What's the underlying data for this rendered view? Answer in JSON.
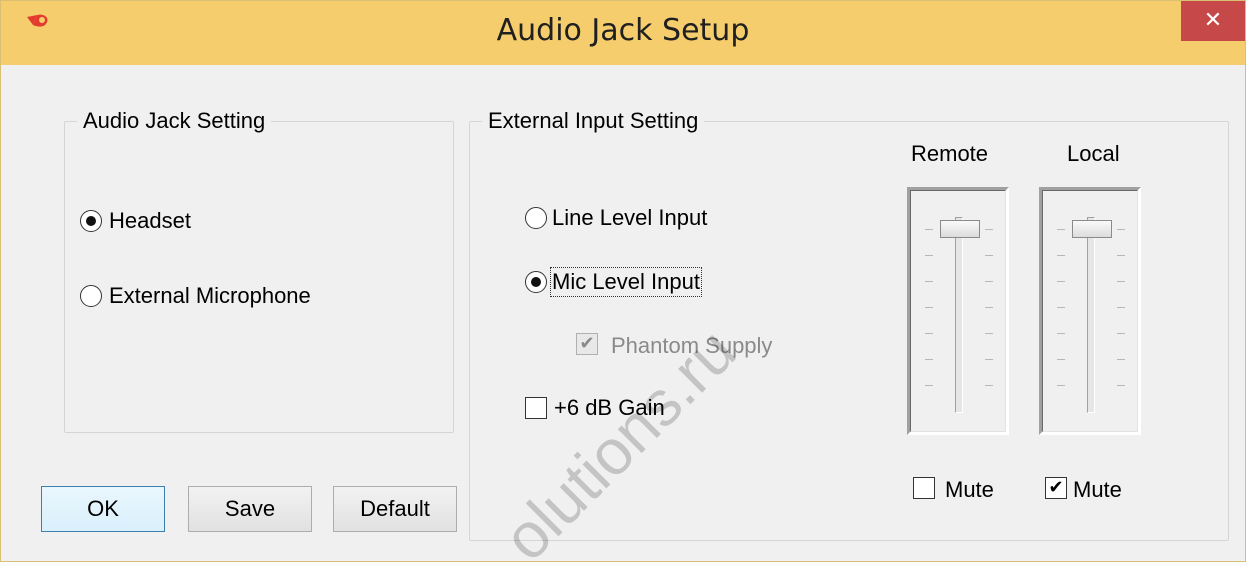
{
  "window": {
    "title": "Audio Jack Setup",
    "close_glyph": "✕",
    "icon": "app-logo-icon"
  },
  "audio_jack": {
    "legend": "Audio Jack Setting",
    "options": [
      {
        "label": "Headset",
        "selected": true
      },
      {
        "label": "External Microphone",
        "selected": false
      }
    ]
  },
  "external_input": {
    "legend": "External Input Setting",
    "options": [
      {
        "label": "Line Level Input",
        "selected": false
      },
      {
        "label": "Mic Level Input",
        "selected": true
      }
    ],
    "phantom_supply": {
      "label": "Phantom Supply",
      "checked": true,
      "enabled": false
    },
    "gain": {
      "label": "+6 dB Gain",
      "checked": false
    }
  },
  "sliders": {
    "remote": {
      "label": "Remote",
      "mute_label": "Mute",
      "muted": false,
      "level": 0.95
    },
    "local": {
      "label": "Local",
      "mute_label": "Mute",
      "muted": true,
      "level": 0.95
    }
  },
  "buttons": {
    "ok": "OK",
    "save": "Save",
    "default": "Default"
  },
  "watermark": "olutions.ru",
  "colors": {
    "titlebar": "#f5cd6c",
    "close": "#c74848",
    "default_button_border": "#3c7fb1"
  }
}
